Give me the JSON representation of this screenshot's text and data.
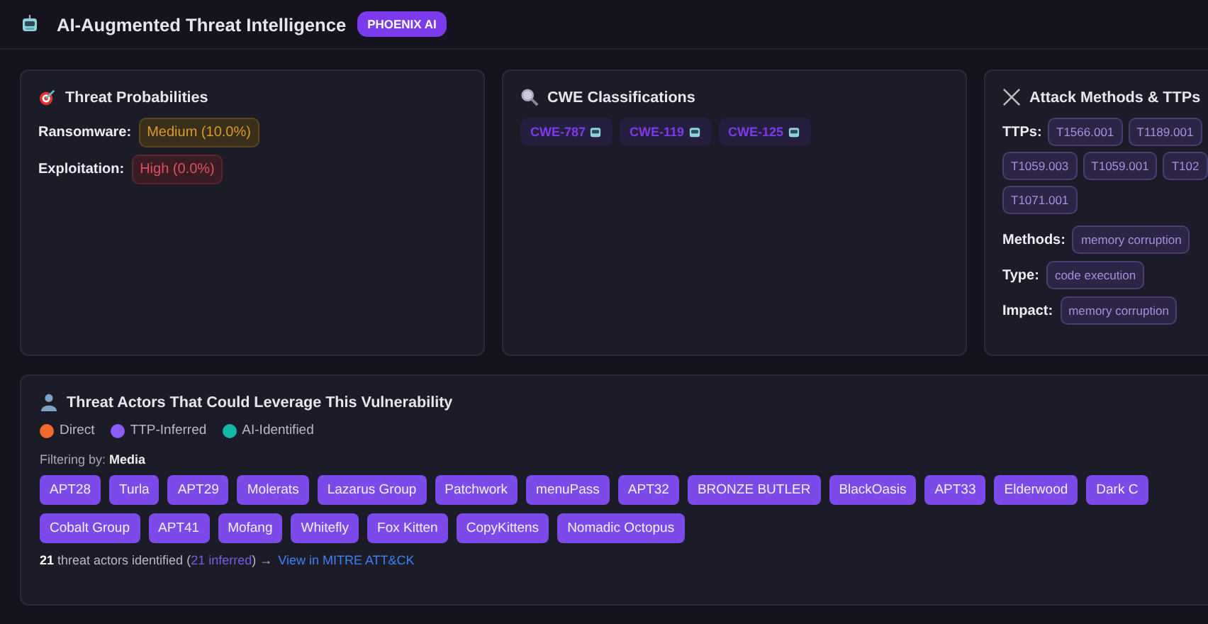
{
  "header": {
    "title": "AI-Augmented Threat Intelligence",
    "badge": "PHOENIX AI"
  },
  "probabilities": {
    "title": "Threat Probabilities",
    "items": [
      {
        "label": "Ransomware:",
        "value": "Medium (10.0%)",
        "kind": "medium"
      },
      {
        "label": "Exploitation:",
        "value": "High (0.0%)",
        "kind": "high"
      }
    ]
  },
  "cwe": {
    "title": "CWE Classifications",
    "items": [
      "CWE-787",
      "CWE-119",
      "CWE-125"
    ]
  },
  "attack": {
    "title": "Attack Methods & TTPs",
    "ttps_label": "TTPs:",
    "ttp_rows": [
      [
        "T1566.001",
        "T1189.001"
      ],
      [
        "T1059.003",
        "T1059.001",
        "T102"
      ],
      [
        "T1071.001"
      ]
    ],
    "fields": [
      {
        "label": "Methods:",
        "value": "memory corruption"
      },
      {
        "label": "Type:",
        "value": "code execution"
      },
      {
        "label": "Impact:",
        "value": "memory corruption"
      }
    ]
  },
  "actors": {
    "title": "Threat Actors That Could Leverage This Vulnerability",
    "legend": [
      {
        "label": "Direct",
        "color": "#f26b2a"
      },
      {
        "label": "TTP-Inferred",
        "color": "#8b5cf6"
      },
      {
        "label": "AI-Identified",
        "color": "#14b8a6"
      }
    ],
    "filter_label": "Filtering by:",
    "filter_value": "Media",
    "rows": [
      [
        "APT28",
        "Turla",
        "APT29",
        "Molerats",
        "Lazarus Group",
        "Patchwork",
        "menuPass",
        "APT32",
        "BRONZE BUTLER",
        "BlackOasis",
        "APT33",
        "Elderwood",
        "Dark C"
      ],
      [
        "Cobalt Group",
        "APT41",
        "Mofang",
        "Whitefly",
        "Fox Kitten",
        "CopyKittens",
        "Nomadic Octopus"
      ]
    ],
    "count": "21",
    "count_text": "threat actors identified (",
    "inferred": "21 inferred",
    "after": ") →",
    "link": "View in MITRE ATT&CK"
  }
}
